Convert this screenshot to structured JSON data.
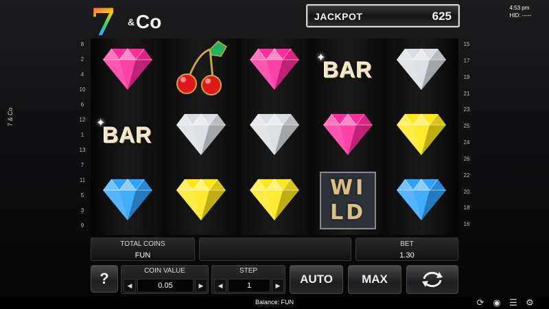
{
  "game": {
    "side_title": "7 & Co",
    "logo": {
      "seven": "7",
      "amp": "&",
      "co": "Co"
    }
  },
  "jackpot": {
    "label": "JACKPOT",
    "value": "625"
  },
  "clock": {
    "time": "4:53 pm",
    "hid": "HID: -----"
  },
  "paylines": {
    "left": [
      "8",
      "2",
      "4",
      "10",
      "6",
      "12",
      "1",
      "13",
      "7",
      "11",
      "5",
      "3",
      "9"
    ],
    "right": [
      "15",
      "17",
      "19",
      "21",
      "23",
      "25",
      "24",
      "26",
      "22",
      "20",
      "18",
      "16"
    ]
  },
  "reels": {
    "rows": [
      [
        "pink-diamond",
        "cherries",
        "pink-diamond",
        "bar",
        "white-diamond"
      ],
      [
        "bar",
        "white-diamond",
        "white-diamond",
        "pink-diamond",
        "yellow-diamond"
      ],
      [
        "blue-diamond",
        "yellow-diamond",
        "yellow-diamond",
        "wild",
        "blue-diamond"
      ]
    ],
    "bar_text": "BAR",
    "wild_text": [
      "WI",
      "LD"
    ]
  },
  "colors": {
    "pink-diamond": "#ff2d9b",
    "white-diamond": "#d9dde2",
    "yellow-diamond": "#ffe81a",
    "blue-diamond": "#2ea3ff",
    "cherry-red": "#e01818",
    "cherry-leaf": "#1fb25a"
  },
  "panel": {
    "total_coins": {
      "label": "TOTAL COINS",
      "value": "FUN"
    },
    "bet": {
      "label": "BET",
      "value": "1.30"
    },
    "coin_value": {
      "label": "COIN VALUE",
      "value": "0.05"
    },
    "step": {
      "label": "STEP",
      "value": "1"
    },
    "help_label": "?",
    "auto_label": "AUTO",
    "max_label": "MAX"
  },
  "status": {
    "balance": "Balance: FUN",
    "icons": [
      "refresh-icon",
      "sound-icon",
      "menu-icon",
      "settings-icon"
    ]
  }
}
